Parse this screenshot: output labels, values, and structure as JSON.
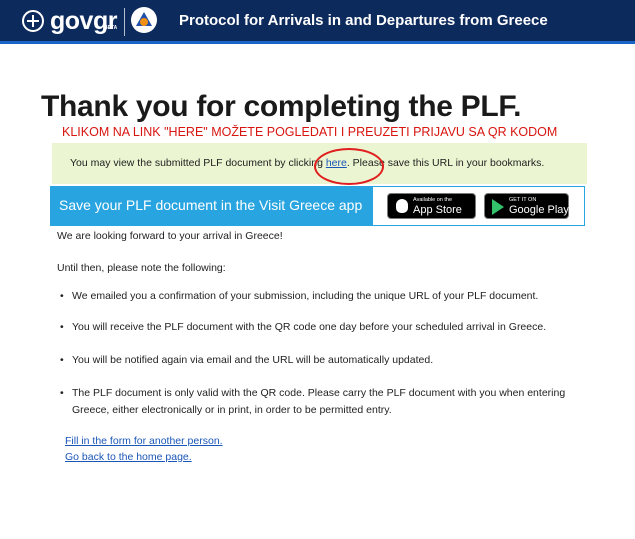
{
  "header": {
    "brand": "govgr",
    "beta": "BETA",
    "title": "Protocol for Arrivals in and Departures from Greece"
  },
  "page_title": "Thank you for completing the PLF.",
  "annotation": "KLIKOM NA LINK \"HERE\" MOŽETE POGLEDATI I PREUZETI PRIJAVU SA QR KODOM",
  "notice": {
    "before": "You may view the submitted PLF document by clicking ",
    "link": "here",
    "after": ". Please save this URL in your bookmarks."
  },
  "app_banner": {
    "text": "Save your PLF document in the Visit Greece app",
    "app_store_small": "Available on the",
    "app_store_big": "App Store",
    "google_play_small": "GET IT ON",
    "google_play_big": "Google Play"
  },
  "intro": "We are looking forward to your arrival in Greece!",
  "note_heading": "Until then, please note the following:",
  "bullets": [
    "We emailed you a confirmation of your submission, including the unique URL of your PLF document.",
    "You will receive the PLF document with the QR code one day before your scheduled arrival in Greece.",
    "You will be notified again via email and the URL will be automatically updated.",
    "The PLF document is only valid with the QR code. Please carry the PLF document with you when entering Greece, either electronically or in print, in order to be permitted entry."
  ],
  "links": {
    "another_person": "Fill in the form for another person.",
    "home": "Go back to the home page."
  },
  "colors": {
    "header_bg": "#0d2a5c",
    "notice_bg": "#ebf5d1",
    "banner_bg": "#28a4e0",
    "annotation": "#d8150f",
    "link": "#1a56b7"
  }
}
